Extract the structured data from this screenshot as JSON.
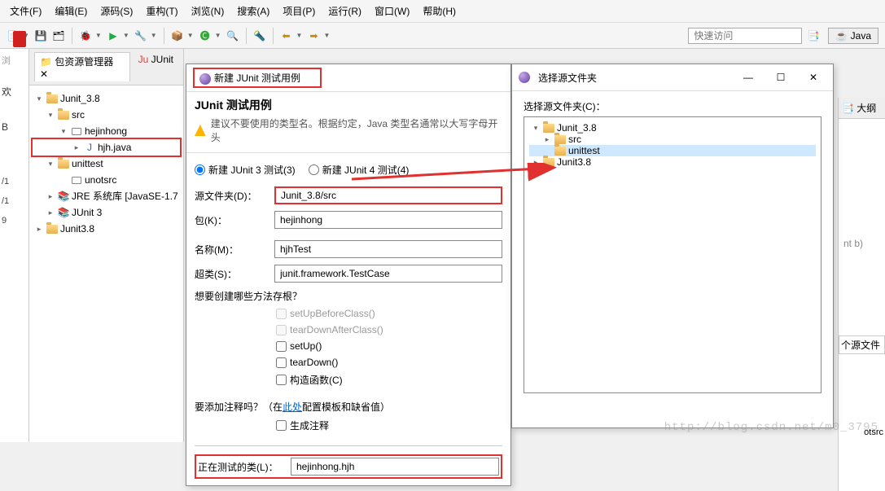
{
  "menu": {
    "file": "文件(F)",
    "edit": "编辑(E)",
    "source": "源码(S)",
    "refactor": "重构(T)",
    "navigate": "浏览(N)",
    "search": "搜索(A)",
    "project": "项目(P)",
    "run": "运行(R)",
    "window": "窗口(W)",
    "help": "帮助(H)"
  },
  "toolbar": {
    "quick_access_placeholder": "快速访问",
    "perspective": "Java"
  },
  "left_edge": {
    "l1": "欢",
    "l2": "B",
    "l3": "/1",
    "l4": "/1",
    "l5": "9"
  },
  "pkg_explorer": {
    "tab1": "包资源管理器",
    "tab2": "JUnit",
    "nodes": {
      "proj1": "Junit_3.8",
      "src": "src",
      "pkg1": "hejinhong",
      "file1": "hjh.java",
      "unittest": "unittest",
      "unotsrc": "unotsrc",
      "jre": "JRE 系统库 [JavaSE-1.7",
      "junit3": "JUnit 3",
      "proj2": "Junit3.8"
    }
  },
  "right": {
    "outline": "大纲",
    "code_hint": "nt b)",
    "src_folder": "个源文件",
    "otsrc": "otsrc"
  },
  "dlg": {
    "title_tab": "新建 JUnit 测试用例",
    "heading": "JUnit 测试用例",
    "warning": "建议不要使用的类型名。根据约定，Java 类型名通常以大写字母开头",
    "radio3": "新建 JUnit 3 测试(3)",
    "radio4": "新建 JUnit 4 测试(4)",
    "lbl_src": "源文件夹(D)：",
    "val_src": "Junit_3.8/src",
    "lbl_pkg": "包(K)：",
    "val_pkg": "hejinhong",
    "lbl_name": "名称(M)：",
    "val_name": "hjhTest",
    "lbl_super": "超类(S)：",
    "val_super": "junit.framework.TestCase",
    "q_stubs": "想要创建哪些方法存根？",
    "chk_setupBC": "setUpBeforeClass()",
    "chk_teardownAC": "tearDownAfterClass()",
    "chk_setup": "setUp()",
    "chk_teardown": "tearDown()",
    "chk_ctor": "构造函数(C)",
    "q_comments_pre": "要添加注释吗？（在",
    "q_comments_link": "此处",
    "q_comments_post": "配置模板和缺省值）",
    "chk_gen": "生成注释",
    "lbl_testing": "正在测试的类(L)：",
    "val_testing": "hejinhong.hjh"
  },
  "fs": {
    "title": "选择源文件夹",
    "prompt": "选择源文件夹(C)：",
    "nodes": {
      "proj1": "Junit_3.8",
      "src": "src",
      "unittest": "unittest",
      "proj2": "Junit3.8"
    }
  },
  "watermark": "http://blog.csdn.net/m0_3795"
}
